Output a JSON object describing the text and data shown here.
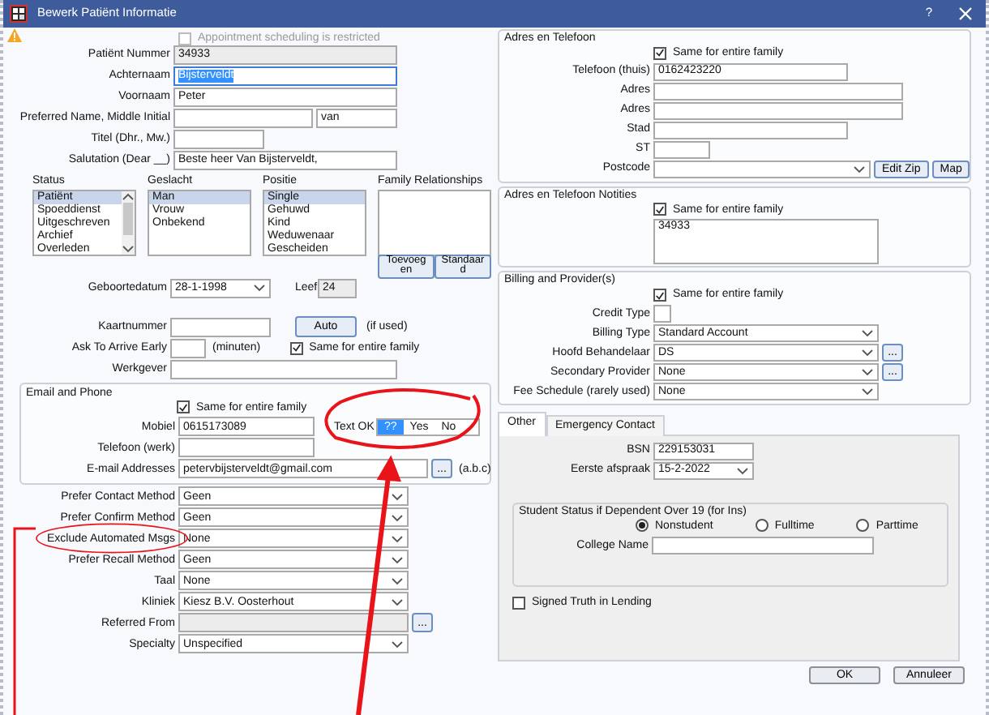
{
  "window": {
    "title": "Bewerk Patiënt Informatie",
    "help": "?"
  },
  "appointment_restricted": {
    "label": "Appointment scheduling is restricted",
    "checked": false,
    "disabled": true
  },
  "patient_fields": [
    {
      "label": "Patiënt Nummer",
      "value": "34933",
      "kind": "readonly",
      "focused": false
    },
    {
      "label": "Achternaam",
      "value": "Bijsterveldt",
      "kind": "text",
      "focused": true
    },
    {
      "label": "Voornaam",
      "value": "Peter",
      "kind": "text",
      "focused": false
    },
    {
      "label": "Preferred Name, Middle Initial",
      "second_value": "van",
      "kind": "text",
      "focused": false
    },
    {
      "label": "Titel (Dhr., Mw.)",
      "kind": "text",
      "focused": false
    },
    {
      "label": "Salutation (Dear __)",
      "value": "Beste heer Van Bijsterveldt,",
      "kind": "text",
      "focused": false
    }
  ],
  "lists": [
    {
      "title": "Status",
      "kind": "scrolling",
      "items": [
        {
          "label": "Patiënt",
          "selected": true
        },
        {
          "label": "Spoeddienst",
          "selected": false
        },
        {
          "label": "Uitgeschreven",
          "selected": false
        },
        {
          "label": "Archief",
          "selected": false
        },
        {
          "label": "Overleden",
          "selected": false
        }
      ]
    },
    {
      "title": "Geslacht",
      "kind": "plain",
      "items": [
        {
          "label": "Man",
          "selected": true
        },
        {
          "label": "Vrouw",
          "selected": false
        },
        {
          "label": "Onbekend",
          "selected": false
        }
      ]
    },
    {
      "title": "Positie",
      "kind": "plain",
      "items": [
        {
          "label": "Single",
          "selected": true
        },
        {
          "label": "Gehuwd",
          "selected": false
        },
        {
          "label": "Kind",
          "selected": false
        },
        {
          "label": "Weduwenaar",
          "selected": false
        },
        {
          "label": "Gescheiden",
          "selected": false
        }
      ]
    }
  ],
  "family_relationships": {
    "title": "Family Relationships",
    "buttons": [
      "Toevoegen",
      "Standaard"
    ]
  },
  "birth": {
    "label": "Geboortedatum",
    "value": "28-1-1998",
    "age_label": "Leef",
    "age": "24"
  },
  "card": {
    "label": "Kaartnummer",
    "button": "Auto",
    "note": "(if used)"
  },
  "arrive": {
    "label": "Ask To Arrive Early",
    "unit": "(minuten)",
    "same_family": {
      "label": "Same for entire family",
      "checked": true
    }
  },
  "employer": {
    "label": "Werkgever"
  },
  "email_phone": {
    "title": "Email and Phone",
    "same_family": {
      "label": "Same for entire family",
      "checked": true
    },
    "mobile": {
      "label": "Mobiel",
      "value": "0615173089"
    },
    "text_ok": {
      "label": "Text OK",
      "options": [
        {
          "label": "??",
          "selected": true
        },
        {
          "label": "Yes",
          "selected": false
        },
        {
          "label": "No",
          "selected": false
        }
      ]
    },
    "work_phone": {
      "label": "Telefoon (werk)"
    },
    "email": {
      "label": "E-mail Addresses",
      "value": "petervbijsterveldt@gmail.com",
      "button": "...",
      "note": "(a.b.c)"
    }
  },
  "preferences": [
    {
      "label": "Prefer Contact Method",
      "value": "Geen",
      "kind": "dropdown"
    },
    {
      "label": "Prefer Confirm Method",
      "value": "Geen",
      "kind": "dropdown"
    },
    {
      "label": "Exclude Automated Msgs",
      "value": "None",
      "kind": "dropdown"
    },
    {
      "label": "Prefer Recall Method",
      "value": "Geen",
      "kind": "dropdown"
    },
    {
      "label": "Taal",
      "value": "None",
      "kind": "dropdown"
    },
    {
      "label": "Kliniek",
      "value": "Kiesz B.V. Oosterhout",
      "kind": "dropdown"
    },
    {
      "label": "Referred From",
      "kind": "lookup",
      "button": "..."
    },
    {
      "label": "Specialty",
      "value": "Unspecified",
      "kind": "dropdown"
    }
  ],
  "address": {
    "title": "Adres en Telefoon",
    "same_family": {
      "label": "Same for entire family",
      "checked": true
    },
    "fields": [
      {
        "label": "Telefoon (thuis)",
        "value": "0162423220",
        "kind": "text"
      },
      {
        "label": "Adres",
        "kind": "text"
      },
      {
        "label": "Adres",
        "kind": "text"
      },
      {
        "label": "Stad",
        "kind": "text"
      },
      {
        "label": "ST",
        "kind": "text"
      },
      {
        "label": "Postcode",
        "kind": "dropdown"
      }
    ],
    "buttons": [
      "Edit Zip",
      "Map"
    ]
  },
  "notes": {
    "title": "Adres en Telefoon Notities",
    "same_family": {
      "label": "Same for entire family",
      "checked": true
    },
    "value": "34933"
  },
  "billing": {
    "title": "Billing and Provider(s)",
    "same_family": {
      "label": "Same for entire family",
      "checked": true
    },
    "fields": [
      {
        "label": "Credit Type",
        "kind": "box"
      },
      {
        "label": "Billing Type",
        "value": "Standard Account",
        "kind": "dropdown"
      },
      {
        "label": "Hoofd Behandelaar",
        "value": "DS",
        "kind": "dropdown",
        "button": "..."
      },
      {
        "label": "Secondary Provider",
        "value": "None",
        "kind": "dropdown",
        "button": "..."
      },
      {
        "label": "Fee Schedule (rarely used)",
        "value": "None",
        "kind": "dropdown"
      }
    ]
  },
  "tabs": [
    {
      "label": "Other",
      "selected": true
    },
    {
      "label": "Emergency Contact",
      "selected": false
    }
  ],
  "other": {
    "bsn": {
      "label": "BSN",
      "value": "229153031"
    },
    "first_appointment": {
      "label": "Eerste afspraak",
      "value": "15-2-2022"
    },
    "student": {
      "title": "Student Status if Dependent Over 19 (for Ins)",
      "options": [
        {
          "label": "Nonstudent",
          "selected": true
        },
        {
          "label": "Fulltime",
          "selected": false
        },
        {
          "label": "Parttime",
          "selected": false
        }
      ],
      "college": {
        "label": "College Name"
      }
    },
    "truth_in_lending": {
      "label": "Signed Truth in Lending",
      "checked": false
    }
  },
  "buttons": [
    "OK",
    "Annuleer"
  ]
}
